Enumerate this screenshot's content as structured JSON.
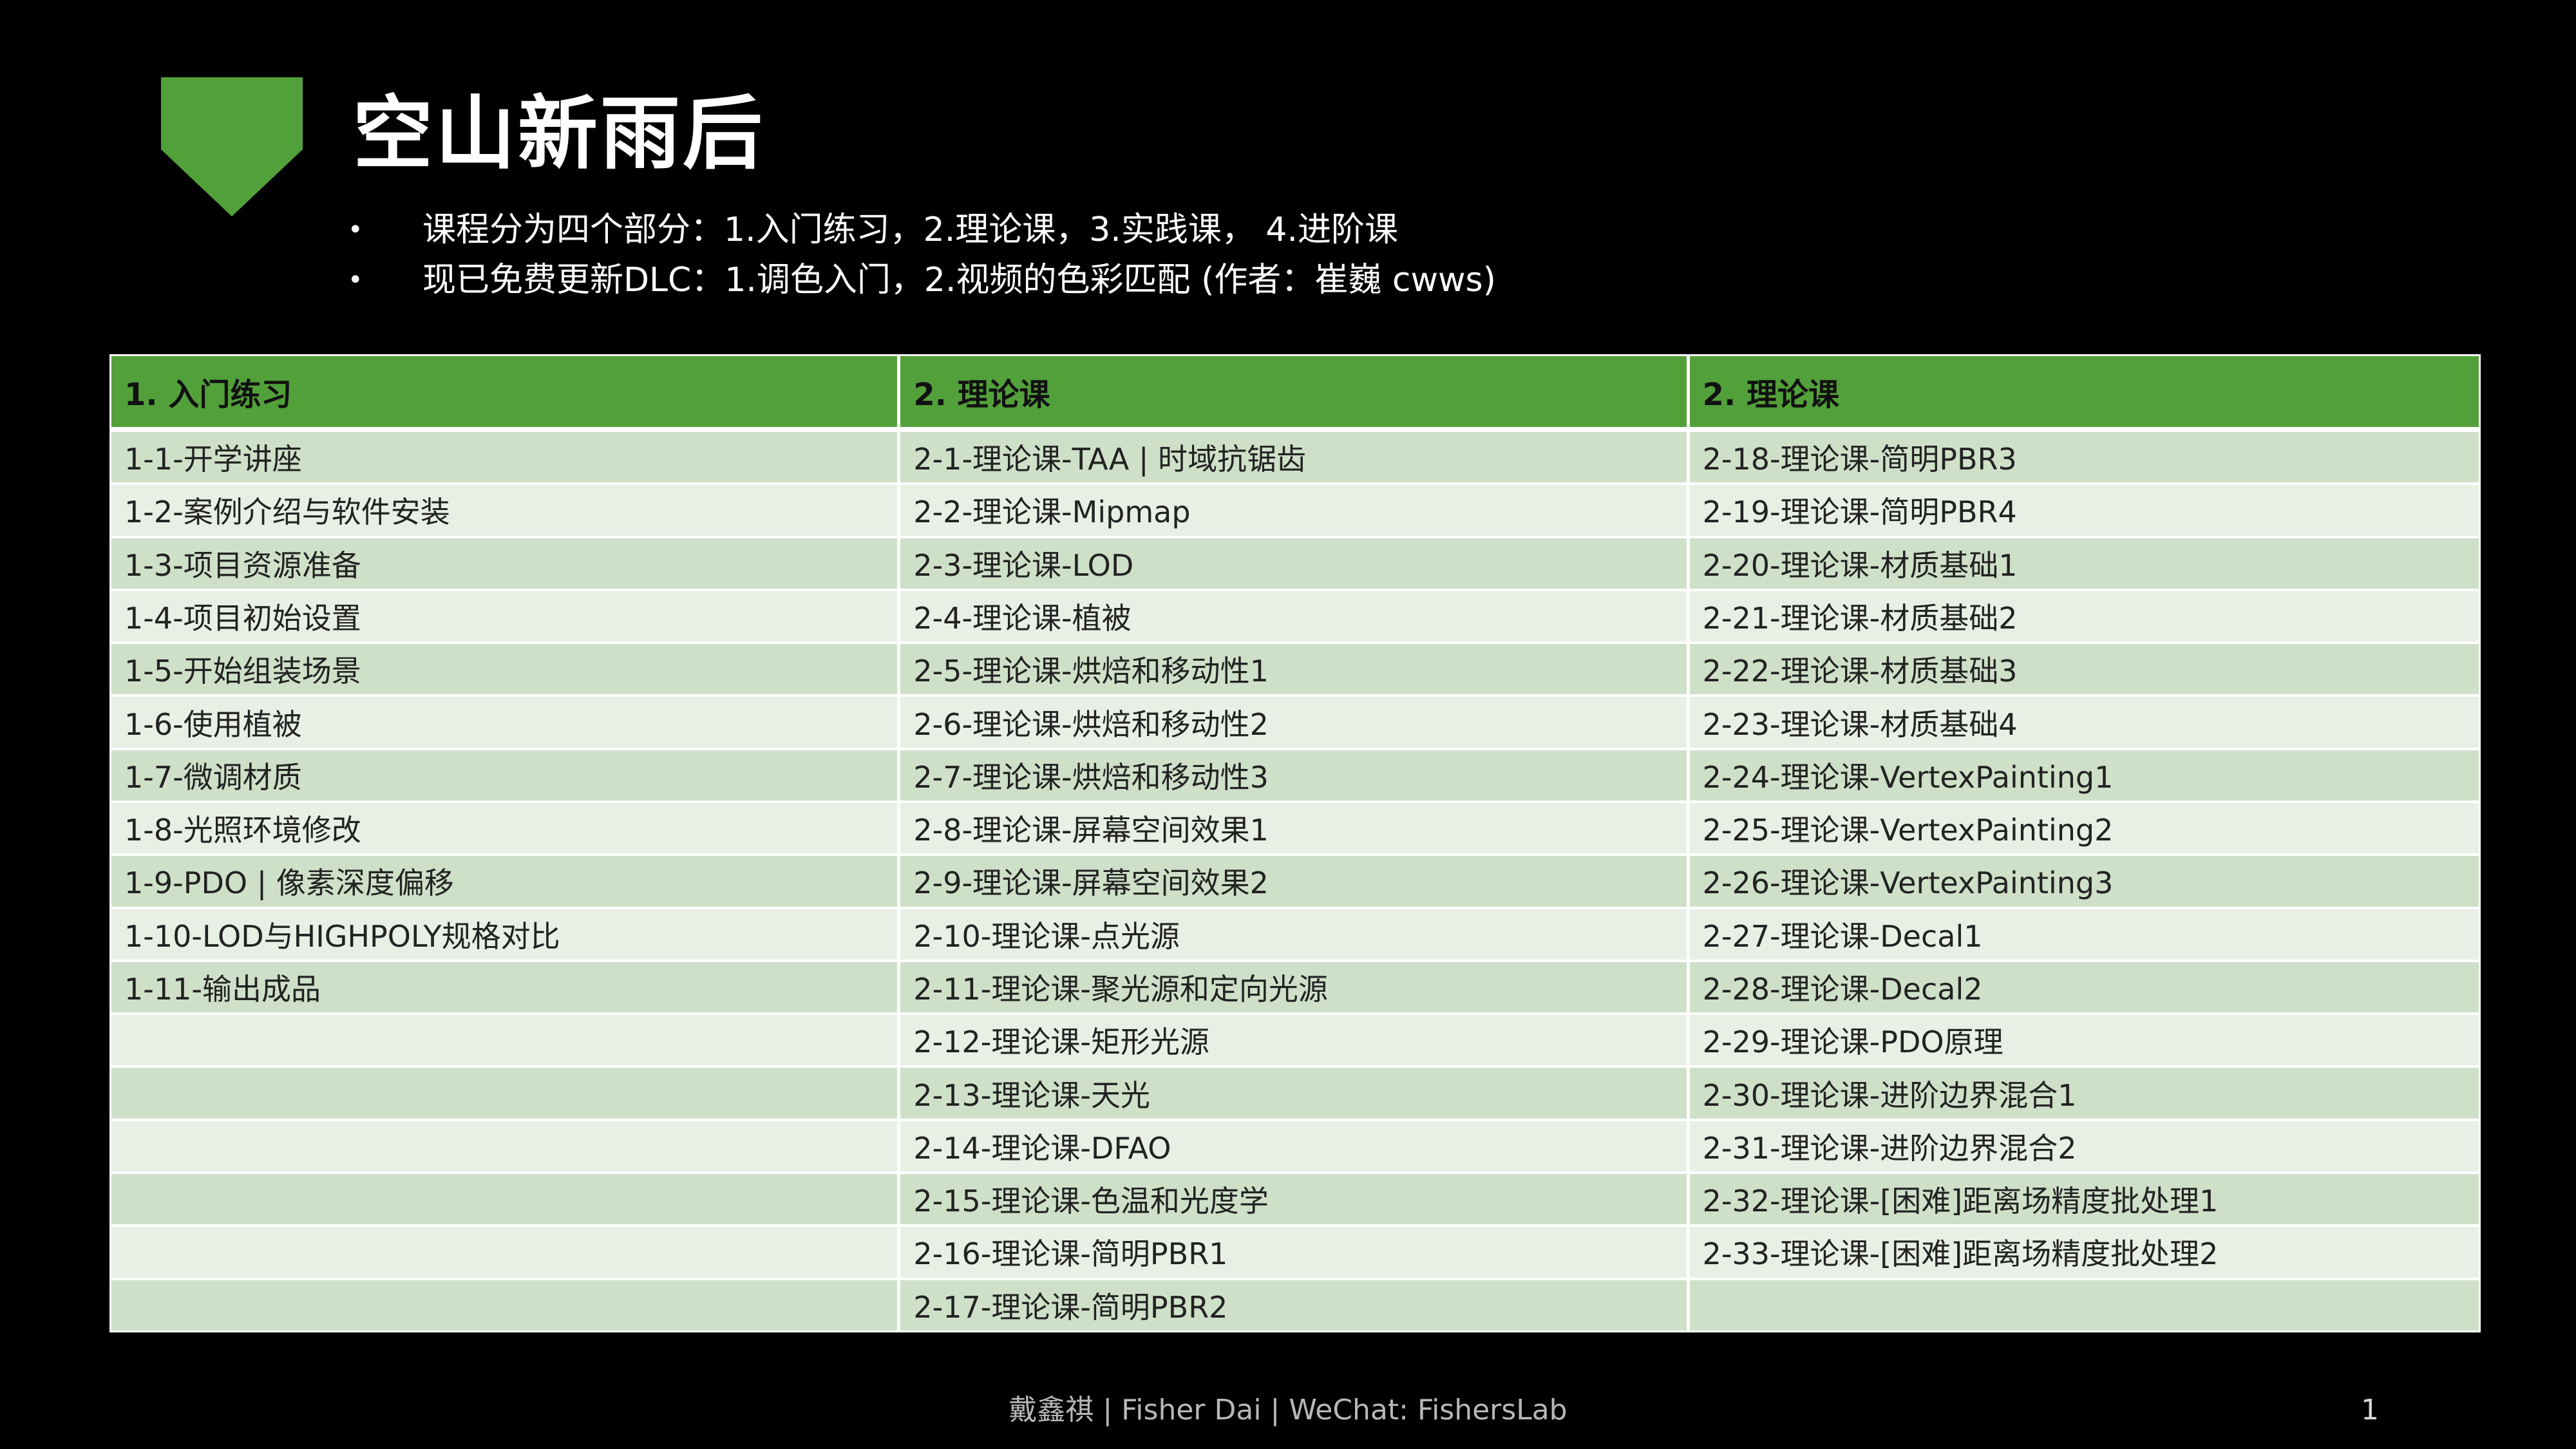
{
  "header": {
    "title": "空山新雨后",
    "logo_icon": "green-pentagon-chevron",
    "accent_color": "#52a03a"
  },
  "bullets": [
    "课程分为四个部分：1.入门练习，2.理论课，3.实践课， 4.进阶课",
    "现已免费更新DLC：1.调色入门，2.视频的色彩匹配 (作者：崔巍 cwws)"
  ],
  "bullet_marker": "•",
  "table": {
    "headers": [
      "1. 入门练习",
      "2. 理论课",
      "2. 理论课"
    ],
    "header_color": "#52a03a",
    "row_colors": [
      "#cfe0c9",
      "#e8efe5"
    ],
    "rows": [
      [
        "1-1-开学讲座",
        "2-1-理论课-TAA | 时域抗锯齿",
        "2-18-理论课-简明PBR3"
      ],
      [
        "1-2-案例介绍与软件安装",
        "2-2-理论课-Mipmap",
        "2-19-理论课-简明PBR4"
      ],
      [
        "1-3-项目资源准备",
        "2-3-理论课-LOD",
        "2-20-理论课-材质基础1"
      ],
      [
        "1-4-项目初始设置",
        "2-4-理论课-植被",
        "2-21-理论课-材质基础2"
      ],
      [
        "1-5-开始组装场景",
        "2-5-理论课-烘焙和移动性1",
        "2-22-理论课-材质基础3"
      ],
      [
        "1-6-使用植被",
        "2-6-理论课-烘焙和移动性2",
        "2-23-理论课-材质基础4"
      ],
      [
        "1-7-微调材质",
        "2-7-理论课-烘焙和移动性3",
        "2-24-理论课-VertexPainting1"
      ],
      [
        "1-8-光照环境修改",
        "2-8-理论课-屏幕空间效果1",
        "2-25-理论课-VertexPainting2"
      ],
      [
        "1-9-PDO | 像素深度偏移",
        "2-9-理论课-屏幕空间效果2",
        "2-26-理论课-VertexPainting3"
      ],
      [
        "1-10-LOD与HIGHPOLY规格对比",
        "2-10-理论课-点光源",
        "2-27-理论课-Decal1"
      ],
      [
        "1-11-输出成品",
        "2-11-理论课-聚光源和定向光源",
        "2-28-理论课-Decal2"
      ],
      [
        "",
        "2-12-理论课-矩形光源",
        "2-29-理论课-PDO原理"
      ],
      [
        "",
        "2-13-理论课-天光",
        "2-30-理论课-进阶边界混合1"
      ],
      [
        "",
        "2-14-理论课-DFAO",
        "2-31-理论课-进阶边界混合2"
      ],
      [
        "",
        "2-15-理论课-色温和光度学",
        "2-32-理论课-[困难]距离场精度批处理1"
      ],
      [
        "",
        "2-16-理论课-简明PBR1",
        "2-33-理论课-[困难]距离场精度批处理2"
      ],
      [
        "",
        "2-17-理论课-简明PBR2",
        ""
      ]
    ]
  },
  "footer": {
    "credit": "戴鑫祺 | Fisher Dai | WeChat: FishersLab",
    "page_number": "1"
  }
}
